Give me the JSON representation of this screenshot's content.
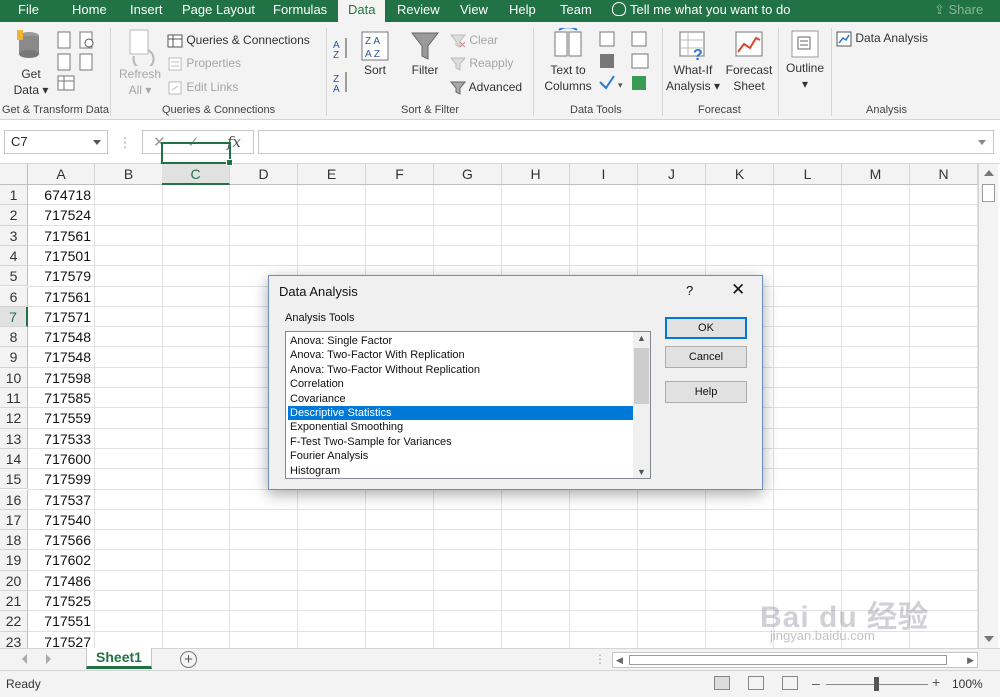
{
  "tabs": [
    "File",
    "Home",
    "Insert",
    "Page Layout",
    "Formulas",
    "Data",
    "Review",
    "View",
    "Help",
    "Team"
  ],
  "active_tab": "Data",
  "tell_me": "Tell me what you want to do",
  "share": "Share",
  "ribbon": {
    "get_transform": {
      "get_data_line1": "Get",
      "get_data_line2": "Data",
      "label": "Get & Transform Data"
    },
    "queries": {
      "refresh_line1": "Refresh",
      "refresh_line2": "All",
      "queries_connections": "Queries & Connections",
      "properties": "Properties",
      "edit_links": "Edit Links",
      "label": "Queries & Connections"
    },
    "sort_filter": {
      "sort": "Sort",
      "filter": "Filter",
      "clear": "Clear",
      "reapply": "Reapply",
      "advanced": "Advanced",
      "label": "Sort & Filter"
    },
    "data_tools": {
      "text_to_line1": "Text to",
      "text_to_line2": "Columns",
      "label": "Data Tools"
    },
    "forecast": {
      "whatif_line1": "What-If",
      "whatif_line2": "Analysis",
      "forecast_line1": "Forecast",
      "forecast_line2": "Sheet",
      "label": "Forecast"
    },
    "outline": {
      "outline": "Outline"
    },
    "analysis": {
      "data_analysis": "Data Analysis",
      "label": "Analysis"
    }
  },
  "formula_bar": {
    "name_box": "C7",
    "fx": "fx",
    "formula": ""
  },
  "columns": [
    "A",
    "B",
    "C",
    "D",
    "E",
    "F",
    "G",
    "H",
    "I",
    "J",
    "K",
    "L",
    "M",
    "N"
  ],
  "selected_column": "C",
  "rows": [
    "1",
    "2",
    "3",
    "4",
    "5",
    "6",
    "7",
    "8",
    "9",
    "10",
    "11",
    "12",
    "13",
    "14",
    "15",
    "16",
    "17",
    "18",
    "19",
    "20",
    "21",
    "22",
    "23"
  ],
  "selected_row": "7",
  "column_a_values": [
    "674718",
    "717524",
    "717561",
    "717501",
    "717579",
    "717561",
    "717571",
    "717548",
    "717548",
    "717598",
    "717585",
    "717559",
    "717533",
    "717600",
    "717599",
    "717537",
    "717540",
    "717566",
    "717602",
    "717486",
    "717525",
    "717551",
    "717527"
  ],
  "dialog": {
    "title": "Data Analysis",
    "help_glyph": "?",
    "close_glyph": "✕",
    "list_label": "Analysis Tools",
    "items": [
      "Anova: Single Factor",
      "Anova: Two-Factor With Replication",
      "Anova: Two-Factor Without Replication",
      "Correlation",
      "Covariance",
      "Descriptive Statistics",
      "Exponential Smoothing",
      "F-Test Two-Sample for Variances",
      "Fourier Analysis",
      "Histogram"
    ],
    "selected_item": "Descriptive Statistics",
    "ok": "OK",
    "cancel": "Cancel",
    "help": "Help"
  },
  "sheet_tab": "Sheet1",
  "status": "Ready",
  "zoom": "100%",
  "watermark": "Bai du 经验",
  "watermark_sub": "jingyan.baidu.com",
  "colors": {
    "excel_green": "#217346",
    "selection_blue": "#0078d7"
  }
}
